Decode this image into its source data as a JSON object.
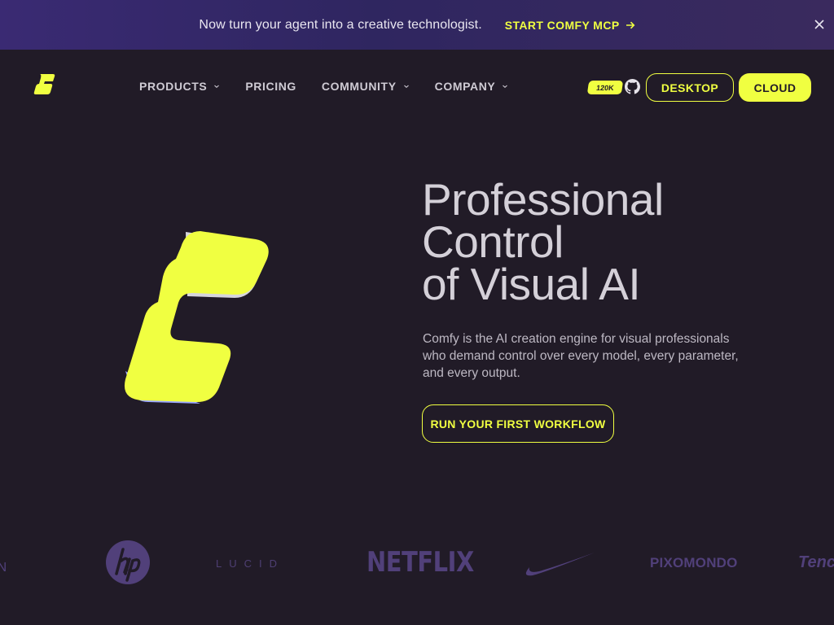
{
  "banner": {
    "text": "Now turn your agent into a creative technologist.",
    "link_label": "START COMFY MCP",
    "arrow_icon": "arrow-right-icon",
    "close_icon": "close-icon"
  },
  "nav": {
    "logo_icon": "comfy-logo-icon",
    "items": [
      {
        "label": "PRODUCTS",
        "has_dropdown": true
      },
      {
        "label": "PRICING",
        "has_dropdown": false
      },
      {
        "label": "COMMUNITY",
        "has_dropdown": true
      },
      {
        "label": "COMPANY",
        "has_dropdown": true
      }
    ],
    "github_stars": "120K",
    "github_icon": "github-icon",
    "desktop_label": "DESKTOP",
    "cloud_label": "CLOUD"
  },
  "hero": {
    "title_lines": [
      "Professional",
      "Control",
      "of Visual AI"
    ],
    "description_lines": [
      "Comfy is the AI creation engine for visual professionals",
      "who demand control over every model, every parameter,",
      "and every output."
    ],
    "cta_label": "RUN YOUR FIRST WORKFLOW"
  },
  "partners": {
    "lucid": "LUCID",
    "netflix": "NETFLIX",
    "pixomondo": "PIXOMONDO",
    "tencent_partial": "Tenc",
    "partial_left": "AN"
  },
  "colors": {
    "background": "#211b27",
    "accent": "#f0ff41",
    "banner": "#3a2a73",
    "partner_logo": "#51407a"
  }
}
